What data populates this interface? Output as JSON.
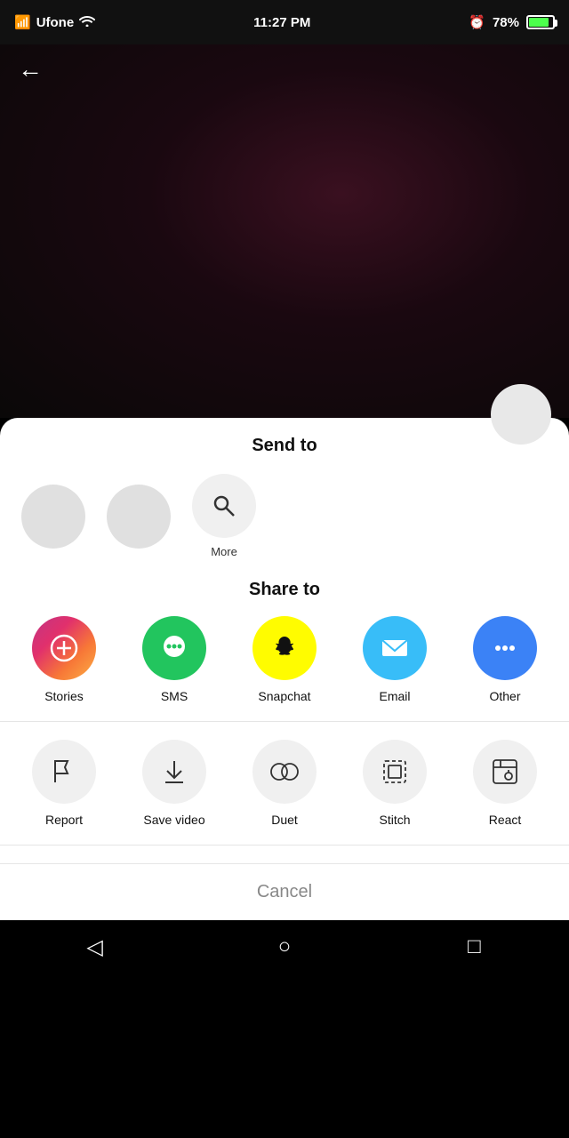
{
  "statusBar": {
    "carrier": "Ufone",
    "time": "11:27 PM",
    "battery": "78%",
    "wifi": true
  },
  "header": {
    "back_label": "←"
  },
  "sendToSection": {
    "title": "Send to",
    "more_label": "More"
  },
  "shareToSection": {
    "title": "Share to",
    "items": [
      {
        "label": "Stories",
        "bg": "stories",
        "icon": "➕"
      },
      {
        "label": "SMS",
        "bg": "sms",
        "icon": "💬"
      },
      {
        "label": "Snapchat",
        "bg": "snapchat",
        "icon": "👻"
      },
      {
        "label": "Email",
        "bg": "email",
        "icon": "✉"
      },
      {
        "label": "Other",
        "bg": "other",
        "icon": "•••"
      }
    ]
  },
  "actionsSection": {
    "items": [
      {
        "label": "Report",
        "icon": "flag"
      },
      {
        "label": "Save video",
        "icon": "download"
      },
      {
        "label": "Duet",
        "icon": "duet"
      },
      {
        "label": "Stitch",
        "icon": "stitch"
      },
      {
        "label": "React",
        "icon": "react"
      }
    ]
  },
  "cancel": {
    "label": "Cancel"
  },
  "navBar": {
    "back": "◁",
    "home": "○",
    "recents": "□"
  }
}
